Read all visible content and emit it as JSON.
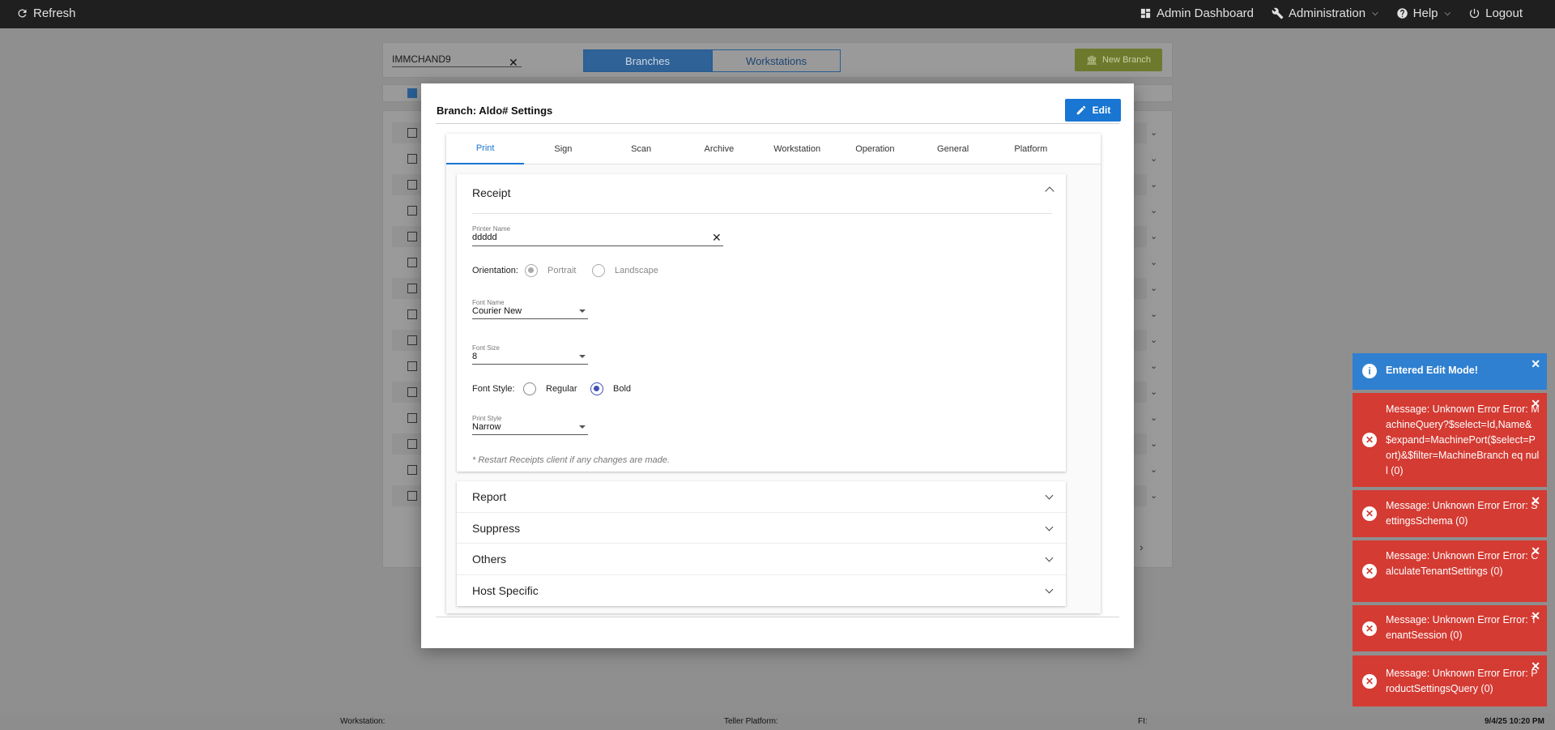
{
  "topbar": {
    "refresh_label": "Refresh",
    "admin_dashboard_label": "Admin Dashboard",
    "administration_label": "Administration",
    "help_label": "Help",
    "logout_label": "Logout"
  },
  "background": {
    "search_value": "IMMCHAND9",
    "tab_branches": "Branches",
    "tab_workstations": "Workstations",
    "new_branch_label": "New Branch"
  },
  "modal": {
    "title": "Branch: Aldo# Settings",
    "edit_label": "Edit",
    "tabs": [
      "Print",
      "Sign",
      "Scan",
      "Archive",
      "Workstation",
      "Operation",
      "General",
      "Platform"
    ],
    "active_tab": "Print",
    "receipt": {
      "title": "Receipt",
      "printer_name_label": "Printer Name",
      "printer_name_value": "ddddd",
      "orientation_label": "Orientation:",
      "orientation_options": [
        "Portrait",
        "Landscape"
      ],
      "orientation_selected": "Portrait",
      "font_name_label": "Font Name",
      "font_name_value": "Courier New",
      "font_size_label": "Font Size",
      "font_size_value": "8",
      "font_style_label": "Font Style:",
      "font_style_options": [
        "Regular",
        "Bold"
      ],
      "font_style_selected": "Bold",
      "print_style_label": "Print Style",
      "print_style_value": "Narrow",
      "note": "* Restart Receipts client if any changes are made."
    },
    "sections": [
      "Report",
      "Suppress",
      "Others",
      "Host Specific"
    ]
  },
  "toasts": [
    {
      "type": "info",
      "text": "Entered Edit Mode!"
    },
    {
      "type": "error",
      "text": "Message: Unknown Error Error: MachineQuery?$select=Id,Name&$expand=MachinePort($select=Port)&$filter=MachineBranch eq null (0)"
    },
    {
      "type": "error",
      "text": "Message: Unknown Error Error: SettingsSchema (0)"
    },
    {
      "type": "error",
      "text": "Message: Unknown Error Error: CalculateTenantSettings (0)"
    },
    {
      "type": "error",
      "text": "Message: Unknown Error Error: TenantSession (0)"
    },
    {
      "type": "error",
      "text": "Message: Unknown Error Error: ProductSettingsQuery (0)"
    }
  ],
  "statusbar": {
    "workstation_label": "Workstation:",
    "teller_platform_label": "Teller Platform:",
    "fi_label": "FI:",
    "datetime": "9/4/25 10:20 PM"
  }
}
